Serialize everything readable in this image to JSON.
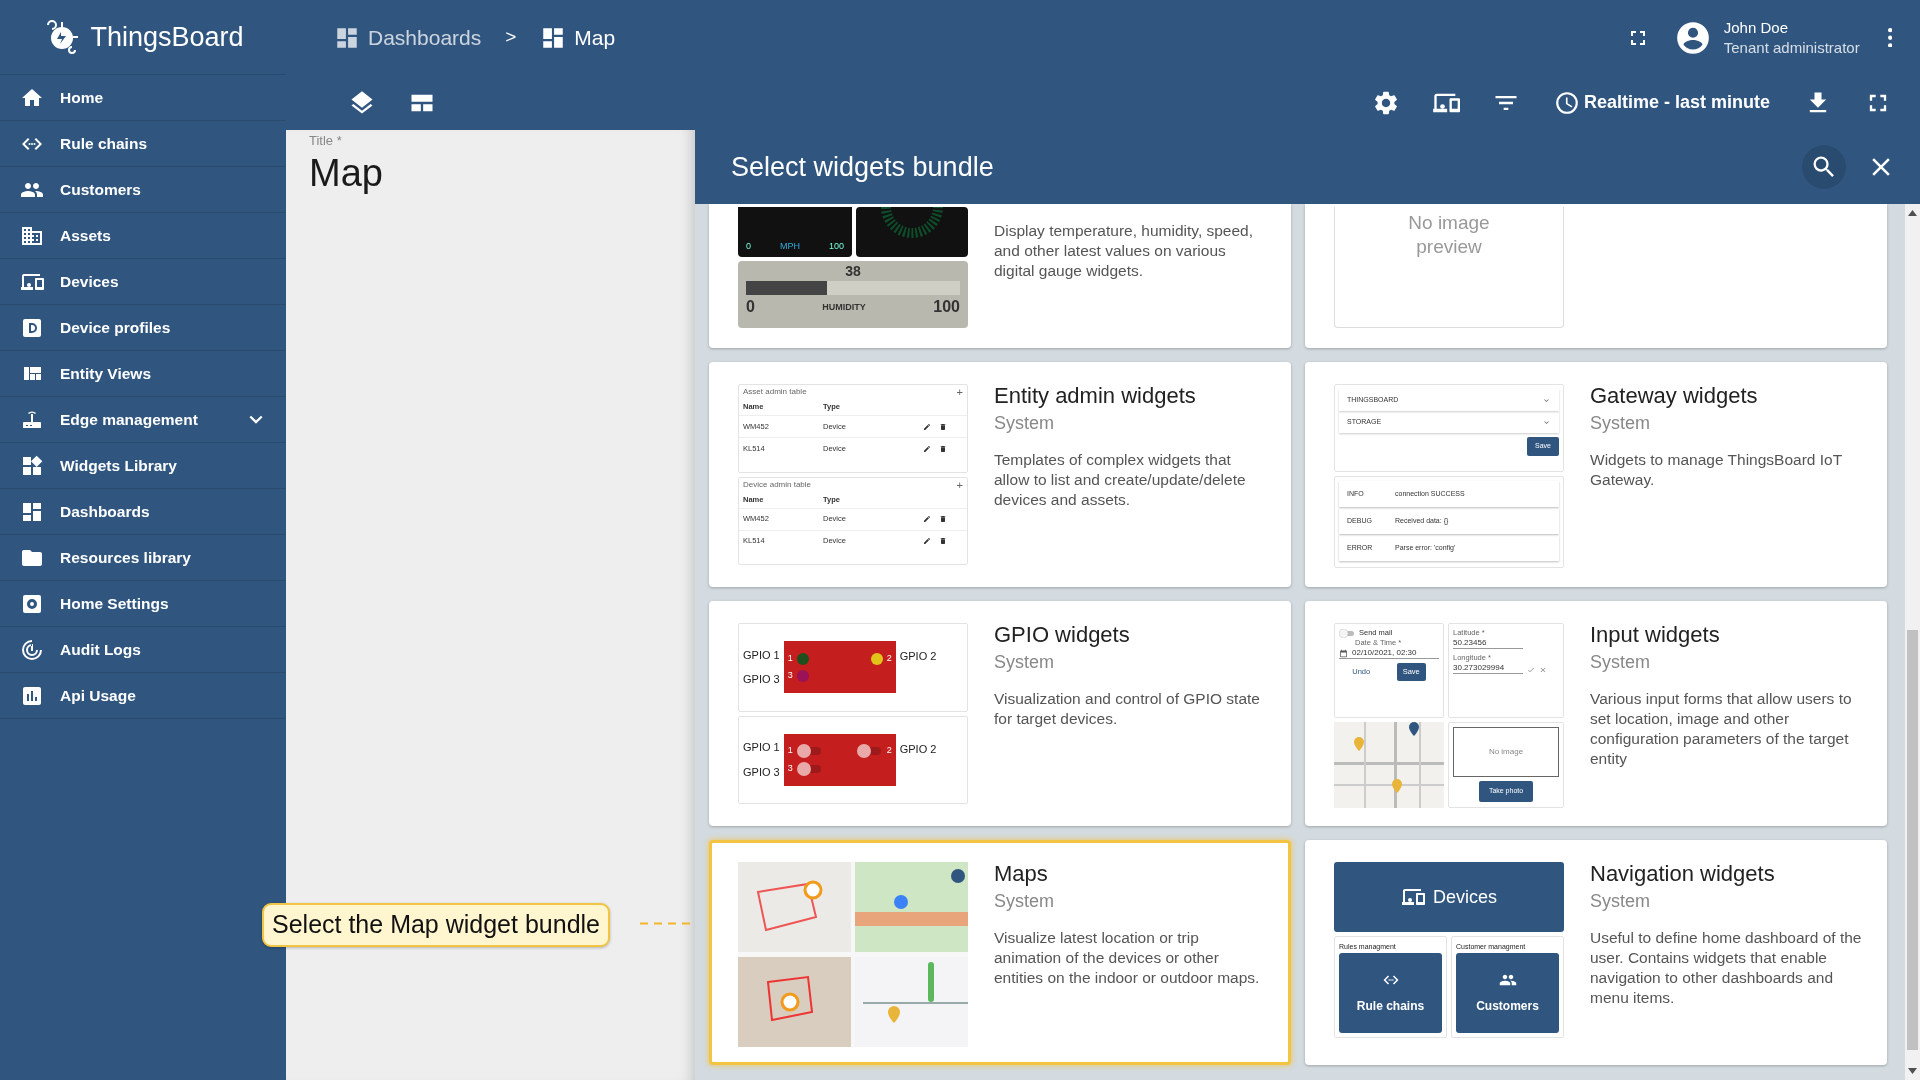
{
  "app": {
    "logo": "ThingsBoard"
  },
  "sidebar": {
    "items": [
      {
        "label": "Home"
      },
      {
        "label": "Rule chains"
      },
      {
        "label": "Customers"
      },
      {
        "label": "Assets"
      },
      {
        "label": "Devices"
      },
      {
        "label": "Device profiles"
      },
      {
        "label": "Entity Views"
      },
      {
        "label": "Edge management",
        "expanded": false
      },
      {
        "label": "Widgets Library"
      },
      {
        "label": "Dashboards"
      },
      {
        "label": "Resources library"
      },
      {
        "label": "Home Settings"
      },
      {
        "label": "Audit Logs"
      },
      {
        "label": "Api Usage"
      }
    ]
  },
  "breadcrumb": {
    "separator": ">",
    "items": [
      {
        "label": "Dashboards",
        "selected": false
      },
      {
        "label": "Map",
        "selected": true
      }
    ]
  },
  "user": {
    "name": "John Doe",
    "role": "Tenant administrator"
  },
  "toolbar": {
    "timewindow": "Realtime - last minute"
  },
  "dashboard_panel": {
    "label": "Title *",
    "value": "Map"
  },
  "dialog": {
    "title": "Select widgets bundle"
  },
  "bundles": [
    {
      "description": "Display temperature, humidity, speed, and other latest values on various digital gauge widgets.",
      "selected": false,
      "preview": {
        "kind": "gauges",
        "speed_min": "0",
        "speed_unit": "MPH",
        "speed_max": "100",
        "value": "38",
        "level": 0.38,
        "min": "0",
        "label": "HUMIDITY",
        "max": "100"
      }
    },
    {
      "selected": false,
      "preview": {
        "kind": "none",
        "text": "No image preview"
      }
    },
    {
      "title": "Entity admin widgets",
      "subtitle": "System",
      "description": "Templates of complex widgets that allow to list and create/update/delete devices and assets.",
      "selected": false,
      "preview": {
        "kind": "entity_tables",
        "tables": [
          {
            "title": "Asset admin table",
            "add": "+",
            "columns": [
              "Name",
              "Type"
            ],
            "rows": [
              [
                "WM452",
                "Device"
              ],
              [
                "KL514",
                "Device"
              ]
            ]
          },
          {
            "title": "Device admin table",
            "add": "+",
            "columns": [
              "Name",
              "Type"
            ],
            "rows": [
              [
                "WM452",
                "Device"
              ],
              [
                "KL514",
                "Device"
              ]
            ]
          }
        ]
      }
    },
    {
      "title": "Gateway widgets",
      "subtitle": "System",
      "description": "Widgets to manage ThingsBoard IoT Gateway.",
      "selected": false,
      "preview": {
        "kind": "gateway",
        "selects": [
          "THINGSBOARD",
          "STORAGE"
        ],
        "button": "Save",
        "logs": [
          [
            "INFO",
            "connection SUCCESS"
          ],
          [
            "DEBUG",
            "Received data: {}"
          ],
          [
            "ERROR",
            "Parse error: 'config'"
          ]
        ]
      }
    },
    {
      "title": "GPIO widgets",
      "subtitle": "System",
      "description": "Visualization and control of GPIO state for target devices.",
      "selected": false,
      "preview": {
        "kind": "gpio",
        "panels": [
          {
            "kind": "leds",
            "left": [
              "GPIO 1",
              "GPIO 3"
            ],
            "right": "GPIO 2",
            "pins": [
              {
                "label": "1",
                "color": "#1f4f1c"
              },
              {
                "label": "2",
                "color": "#e2c31a"
              },
              {
                "label": "3",
                "color": "#9b1258"
              }
            ]
          },
          {
            "kind": "switches",
            "left": [
              "GPIO 1",
              "GPIO 3"
            ],
            "right": "GPIO 2",
            "pins": [
              {
                "label": "1",
                "on": false
              },
              {
                "label": "2",
                "on": false
              },
              {
                "label": "3",
                "on": false
              }
            ]
          }
        ]
      }
    },
    {
      "title": "Input widgets",
      "subtitle": "System",
      "description": "Various input forms that allow users to set location, image and other configuration parameters of the target entity",
      "selected": false,
      "preview": {
        "kind": "inputs",
        "switch_label": "Send mail",
        "switch_on": false,
        "date_label": "Date & Time *",
        "date_value": "02/10/2021, 02:30",
        "buttons": [
          "Undo",
          "Save"
        ],
        "lat_label": "Latitude *",
        "lat_value": "50.23456",
        "lon_label": "Longitude *",
        "lon_value": "30.273029994",
        "image_text": "No image",
        "photo_button": "Take photo"
      }
    },
    {
      "title": "Maps",
      "subtitle": "System",
      "description": "Visualize latest location or trip animation of the devices or other entities on the indoor or outdoor maps.",
      "selected": true
    },
    {
      "title": "Navigation widgets",
      "subtitle": "System",
      "description": "Useful to define home dashboard of the user. Contains widgets that enable navigation to other dashboards and menu items.",
      "selected": false,
      "preview": {
        "kind": "navigation",
        "main": "Devices",
        "groups": [
          {
            "title": "Rules managment",
            "button": "Rule chains"
          },
          {
            "title": "Customer managment",
            "button": "Customers"
          }
        ]
      }
    }
  ],
  "callout": {
    "text": "Select the Map widget bundle"
  }
}
